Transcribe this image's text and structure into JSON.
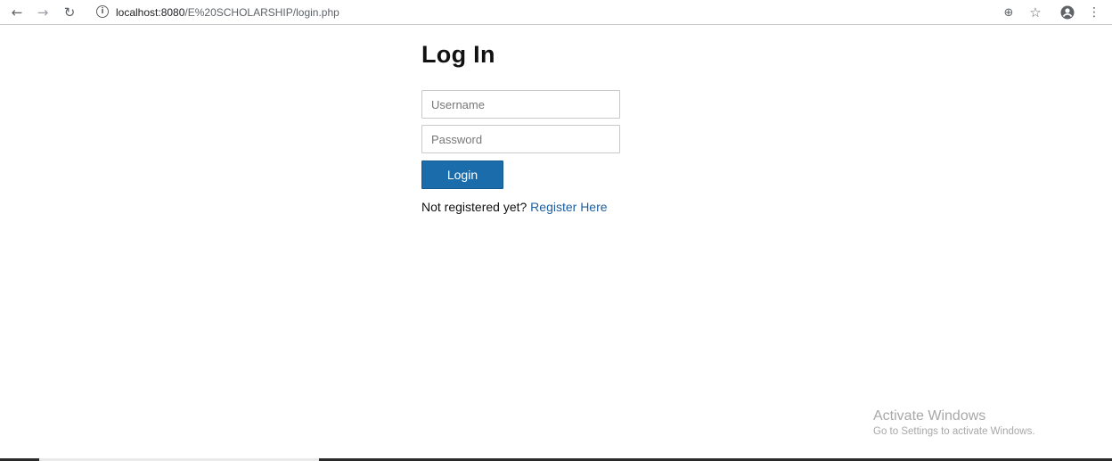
{
  "browser": {
    "url_host": "localhost:8080",
    "url_path": "/E%20SCHOLARSHIP/login.php",
    "icons": {
      "back": "arrow-left-icon",
      "forward": "arrow-right-icon",
      "reload": "reload-icon",
      "info": "info-icon",
      "zoom": "zoom-icon",
      "bookmark": "star-icon",
      "profile": "account-icon",
      "menu": "kebab-menu-icon"
    }
  },
  "login": {
    "title": "Log In",
    "username_placeholder": "Username",
    "password_placeholder": "Password",
    "button_label": "Login",
    "not_registered_text": "Not registered yet? ",
    "register_link_label": "Register Here"
  },
  "watermark": {
    "title": "Activate Windows",
    "subtitle": "Go to Settings to activate Windows."
  },
  "colors": {
    "button_bg": "#1a6cab",
    "link": "#1d5fa0"
  }
}
